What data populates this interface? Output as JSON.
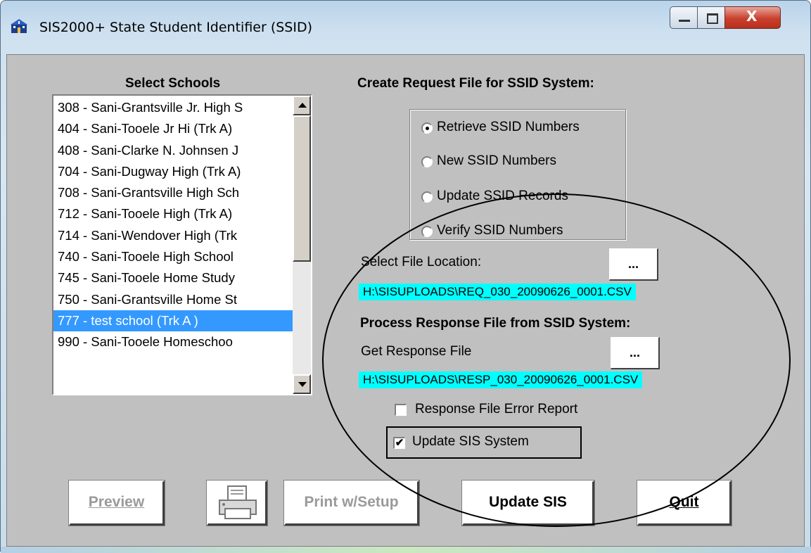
{
  "window": {
    "title": "SIS2000+ State Student Identifier (SSID)",
    "close_glyph": "X"
  },
  "schools": {
    "heading": "Select Schools",
    "items": [
      "308 - Sani-Grantsville Jr. High S",
      "404 - Sani-Tooele Jr Hi (Trk A)",
      "408 - Sani-Clarke N. Johnsen J",
      "704 - Sani-Dugway High (Trk A)",
      "708 - Sani-Grantsville High Sch",
      "712 - Sani-Tooele High (Trk A)",
      "714 - Sani-Wendover High (Trk",
      "740 - Sani-Tooele High School",
      "745 - Sani-Tooele Home Study",
      "750 - Sani-Grantsville Home St",
      "777 - test school (Trk A )",
      "990 - Sani-Tooele Homeschoo"
    ],
    "selected_index": 10
  },
  "request": {
    "heading": "Create Request File for SSID System:",
    "options": [
      "Retrieve SSID Numbers",
      "New SSID Numbers",
      "Update SSID Records",
      "Verify SSID Numbers"
    ],
    "selected_index": 0,
    "file_location_label": "Select File Location:",
    "browse_label": "...",
    "file_path": "H:\\SISUPLOADS\\REQ_030_20090626_0001.CSV"
  },
  "response": {
    "heading": "Process Response File from SSID System:",
    "get_label": "Get Response File",
    "browse_label": "...",
    "file_path": "H:\\SISUPLOADS\\RESP_030_20090626_0001.CSV",
    "error_report_label": "Response File Error Report",
    "error_report_checked": false,
    "update_sis_label": "Update SIS System",
    "update_sis_checked": true,
    "check_glyph": "✔"
  },
  "buttons": {
    "preview": "Preview",
    "print_setup": "Print w/Setup",
    "update_sis": "Update SIS",
    "quit": "Quit"
  },
  "colors": {
    "selection": "#3399ff",
    "path_highlight": "#00ffff",
    "face": "#c0c0c0"
  }
}
